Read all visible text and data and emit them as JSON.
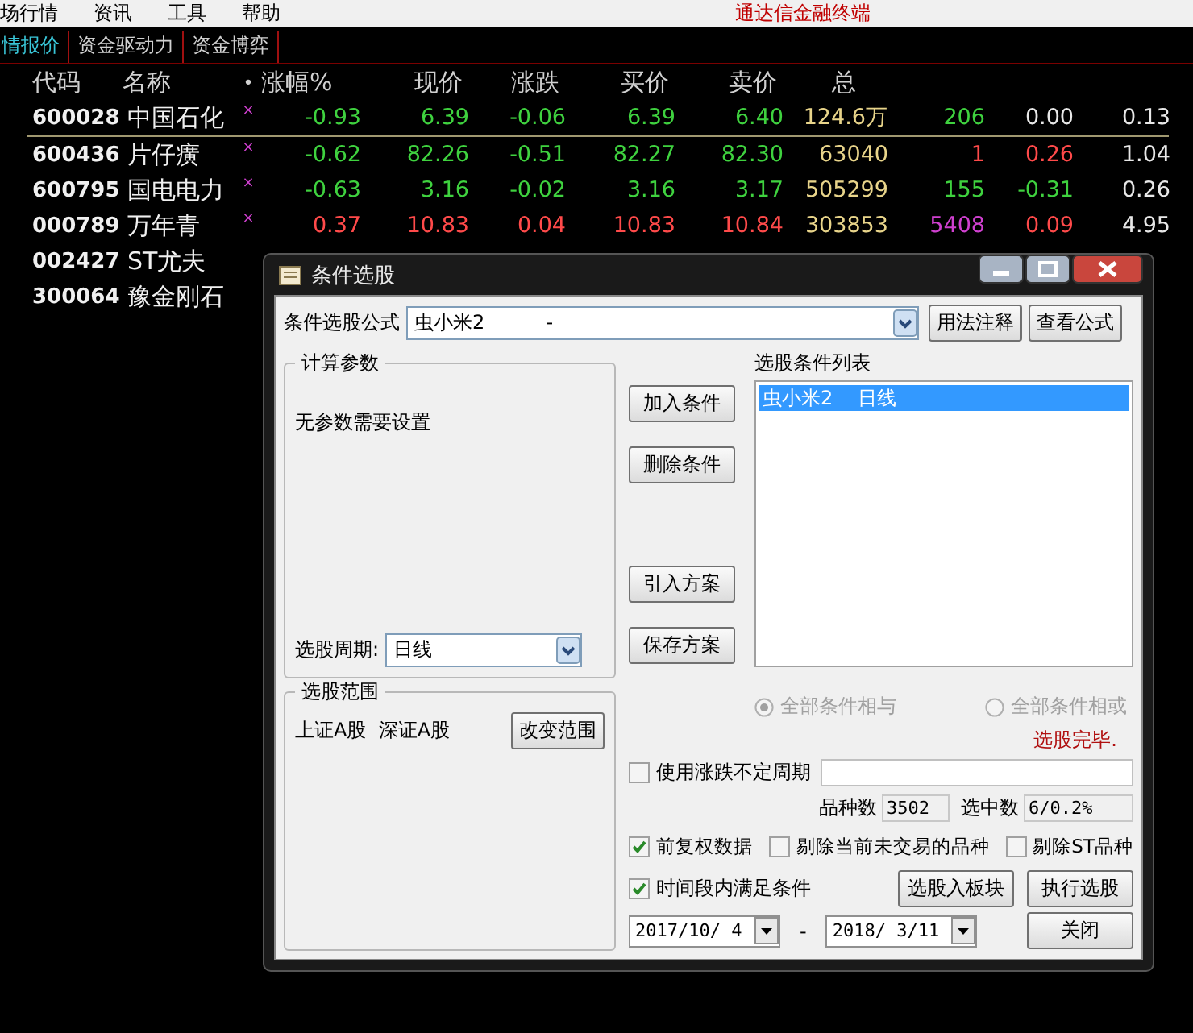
{
  "menu": {
    "items": [
      "场行情",
      "资讯",
      "工具",
      "帮助"
    ],
    "app_title": "通达信金融终端"
  },
  "tabs": [
    {
      "label": "情报价",
      "selected": true
    },
    {
      "label": "资金驱动力",
      "selected": false
    },
    {
      "label": "资金博弈",
      "selected": false
    }
  ],
  "table": {
    "columns": [
      "代码",
      "名称",
      "•",
      "涨幅%",
      "现价",
      "涨跌",
      "买价",
      "卖价",
      "总"
    ],
    "rows": [
      {
        "underline": true,
        "cells": [
          {
            "text": "600028"
          },
          {
            "text": "中国石化"
          },
          {
            "text": "×"
          },
          {
            "text": "-0.93",
            "color": "#3fd23f"
          },
          {
            "text": "6.39",
            "color": "#3fd23f"
          },
          {
            "text": "-0.06",
            "color": "#3fd23f"
          },
          {
            "text": "6.39",
            "color": "#3fd23f"
          },
          {
            "text": "6.40",
            "color": "#3fd23f"
          },
          {
            "text": "124.6万",
            "color": "#e8d48a"
          },
          {
            "text": "206",
            "color": "#3fd23f"
          },
          {
            "text": "0.00",
            "color": "#e8e8e8"
          },
          {
            "text": "0.13",
            "color": "#e8e8e8"
          }
        ]
      },
      {
        "underline": false,
        "cells": [
          {
            "text": "600436"
          },
          {
            "text": "片仔癀"
          },
          {
            "text": "×"
          },
          {
            "text": "-0.62",
            "color": "#3fd23f"
          },
          {
            "text": "82.26",
            "color": "#3fd23f"
          },
          {
            "text": "-0.51",
            "color": "#3fd23f"
          },
          {
            "text": "82.27",
            "color": "#3fd23f"
          },
          {
            "text": "82.30",
            "color": "#3fd23f"
          },
          {
            "text": "63040",
            "color": "#e8d48a"
          },
          {
            "text": "1",
            "color": "#ff4a4a"
          },
          {
            "text": "0.26",
            "color": "#ff4a4a"
          },
          {
            "text": "1.04",
            "color": "#e8e8e8"
          }
        ]
      },
      {
        "underline": false,
        "cells": [
          {
            "text": "600795"
          },
          {
            "text": "国电电力"
          },
          {
            "text": "×"
          },
          {
            "text": "-0.63",
            "color": "#3fd23f"
          },
          {
            "text": "3.16",
            "color": "#3fd23f"
          },
          {
            "text": "-0.02",
            "color": "#3fd23f"
          },
          {
            "text": "3.16",
            "color": "#3fd23f"
          },
          {
            "text": "3.17",
            "color": "#3fd23f"
          },
          {
            "text": "505299",
            "color": "#e8d48a"
          },
          {
            "text": "155",
            "color": "#3fd23f"
          },
          {
            "text": "-0.31",
            "color": "#3fd23f"
          },
          {
            "text": "0.26",
            "color": "#e8e8e8"
          }
        ]
      },
      {
        "underline": false,
        "cells": [
          {
            "text": "000789"
          },
          {
            "text": "万年青"
          },
          {
            "text": "×"
          },
          {
            "text": "0.37",
            "color": "#ff4a4a"
          },
          {
            "text": "10.83",
            "color": "#ff4a4a"
          },
          {
            "text": "0.04",
            "color": "#ff4a4a"
          },
          {
            "text": "10.83",
            "color": "#ff4a4a"
          },
          {
            "text": "10.84",
            "color": "#ff4a4a"
          },
          {
            "text": "303853",
            "color": "#e8d48a"
          },
          {
            "text": "5408",
            "color": "#d040d0"
          },
          {
            "text": "0.09",
            "color": "#ff4a4a"
          },
          {
            "text": "4.95",
            "color": "#e8e8e8"
          }
        ]
      },
      {
        "underline": false,
        "cells": [
          {
            "text": "002427"
          },
          {
            "text": "ST尤夫"
          }
        ]
      },
      {
        "underline": false,
        "cells": [
          {
            "text": "300064"
          },
          {
            "text": "豫金刚石"
          }
        ]
      }
    ]
  },
  "dialog": {
    "title": "条件选股",
    "formula_label": "条件选股公式",
    "formula_value": "虫小米2          -",
    "usage_button": "用法注释",
    "view_button": "查看公式",
    "params_group": "计算参数",
    "params_text": "无参数需要设置",
    "period_label": "选股周期:",
    "period_value": "日线",
    "range_group": "选股范围",
    "range_text": "上证A股  深证A股",
    "range_button": "改变范围",
    "action_buttons": [
      "加入条件",
      "删除条件",
      "引入方案",
      "保存方案"
    ],
    "list_label": "选股条件列表",
    "list_items": [
      {
        "text": "虫小米2    日线",
        "selected": true
      }
    ],
    "radios": [
      {
        "label": "全部条件相与",
        "selected": true,
        "disabled": true
      },
      {
        "label": "全部条件相或",
        "selected": false,
        "disabled": true
      }
    ],
    "status": "选股完毕.",
    "variable_period": {
      "label": "使用涨跌不定周期",
      "checked": false
    },
    "count_label": "品种数",
    "count_value": "3502",
    "selected_label": "选中数",
    "selected_value": "6/0.2%",
    "options": [
      {
        "label": "前复权数据",
        "checked": true
      },
      {
        "label": "剔除当前未交易的品种",
        "checked": false
      },
      {
        "label": "剔除ST品种",
        "checked": false
      }
    ],
    "time_range": {
      "label": "时间段内满足条件",
      "checked": true
    },
    "to_block_button": "选股入板块",
    "run_button": "执行选股",
    "close_button": "关闭",
    "date_from": "2017/10/ 4",
    "date_sep": "-",
    "date_to": "2018/ 3/11"
  }
}
